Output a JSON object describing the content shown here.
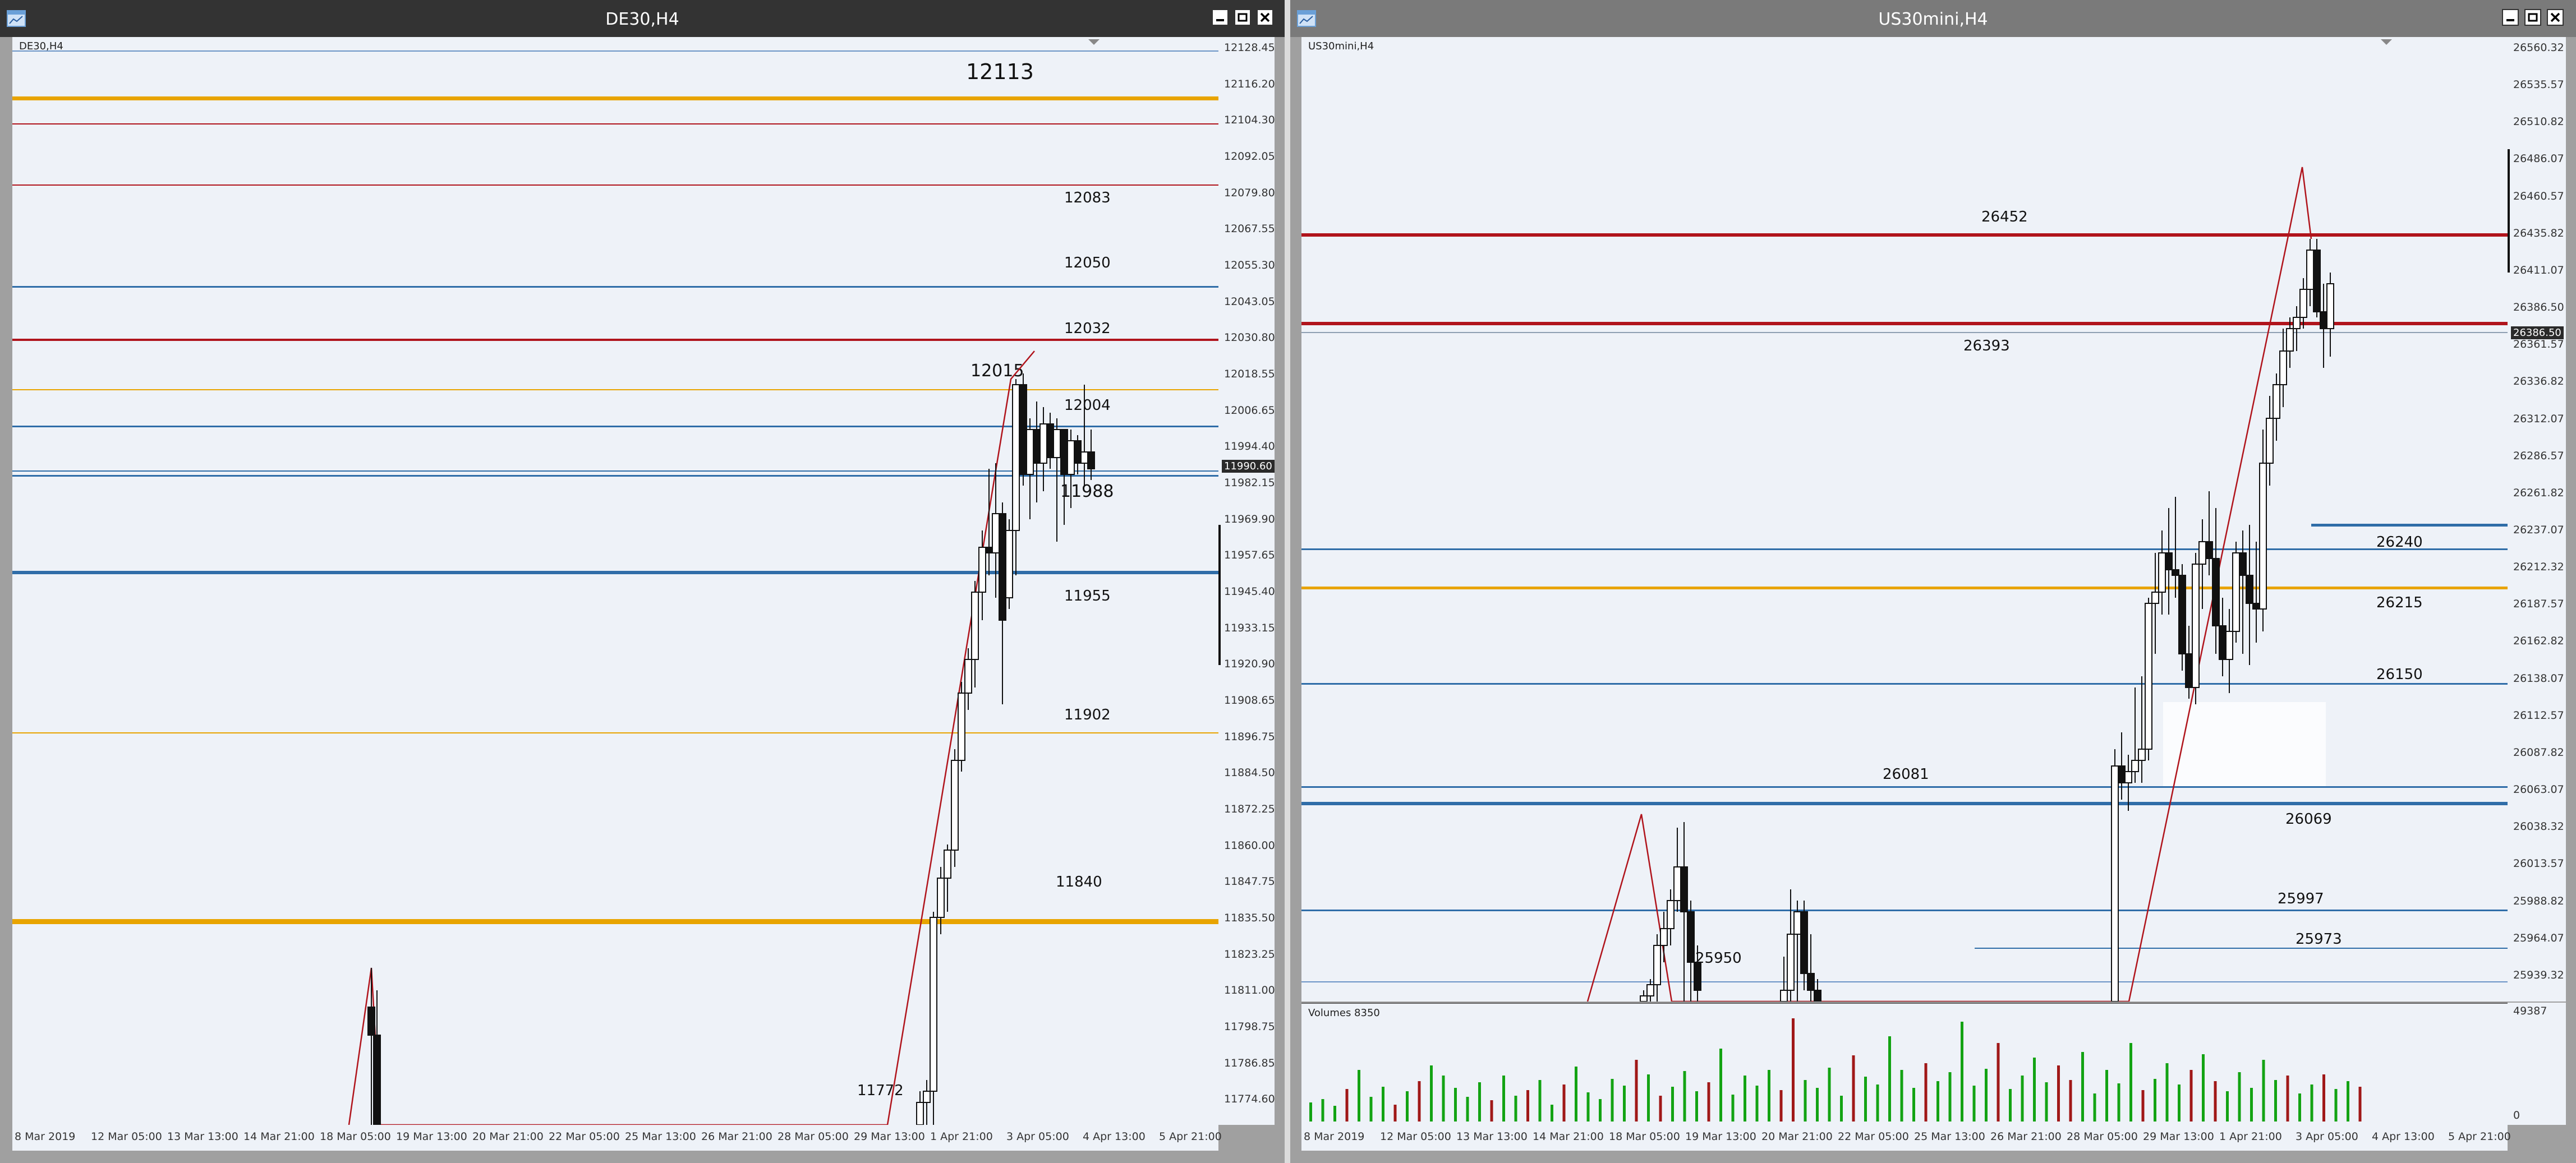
{
  "windows": [
    {
      "title": "DE30,H4",
      "symbol_label": "DE30,H4",
      "price_tag": "11990.60",
      "big_label": "12113",
      "y_ticks": [
        "12128.45",
        "12116.20",
        "12104.30",
        "12092.05",
        "12079.80",
        "12067.55",
        "12055.30",
        "12043.05",
        "12030.80",
        "12018.55",
        "12006.65",
        "11994.40",
        "11982.15",
        "11969.90",
        "11957.65",
        "11945.40",
        "11933.15",
        "11920.90",
        "11908.65",
        "11896.75",
        "11884.50",
        "11872.25",
        "11860.00",
        "11847.75",
        "11835.50",
        "11823.25",
        "11811.00",
        "11798.75",
        "11786.85",
        "11774.60"
      ],
      "x_ticks": [
        "8 Mar 2019",
        "12 Mar 05:00",
        "13 Mar 13:00",
        "14 Mar 21:00",
        "18 Mar 05:00",
        "19 Mar 13:00",
        "20 Mar 21:00",
        "22 Mar 05:00",
        "25 Mar 13:00",
        "26 Mar 21:00",
        "28 Mar 05:00",
        "29 Mar 13:00",
        "1 Apr 21:00",
        "3 Apr 05:00",
        "4 Apr 13:00",
        "5 Apr 21:00"
      ],
      "levels": [
        "12083",
        "12050",
        "12032",
        "12015",
        "12004",
        "11988",
        "11955",
        "11902",
        "11840",
        "11772"
      ]
    },
    {
      "title": "US30mini,H4",
      "symbol_label": "US30mini,H4",
      "price_tag": "26386.50",
      "volume_label": "Volumes 8350",
      "volume_scale": [
        "49387",
        "0"
      ],
      "y_ticks": [
        "26560.32",
        "26535.57",
        "26510.82",
        "26486.07",
        "26460.57",
        "26435.82",
        "26411.07",
        "26386.50",
        "26361.57",
        "26336.82",
        "26312.07",
        "26286.57",
        "26261.82",
        "26237.07",
        "26212.32",
        "26187.57",
        "26162.82",
        "26138.07",
        "26112.57",
        "26087.82",
        "26063.07",
        "26038.32",
        "26013.57",
        "25988.82",
        "25964.07",
        "25939.32"
      ],
      "x_ticks": [
        "8 Mar 2019",
        "12 Mar 05:00",
        "13 Mar 13:00",
        "14 Mar 21:00",
        "18 Mar 05:00",
        "19 Mar 13:00",
        "20 Mar 21:00",
        "22 Mar 05:00",
        "25 Mar 13:00",
        "26 Mar 21:00",
        "28 Mar 05:00",
        "29 Mar 13:00",
        "1 Apr 21:00",
        "3 Apr 05:00",
        "4 Apr 13:00",
        "5 Apr 21:00"
      ],
      "levels": [
        "26452",
        "26393",
        "26240",
        "26215",
        "26150",
        "26081",
        "26069",
        "25997",
        "25973",
        "25950"
      ]
    }
  ],
  "colors": {
    "titlebar_active": "#333333",
    "titlebar_inactive": "#7a7a7a",
    "chart_bg": "#eef2f8",
    "red_line": "#b0141c",
    "blue_line": "#2f6da8",
    "gold_line": "#e8a400",
    "volume_up": "#13a313",
    "volume_down": "#a01818"
  },
  "icons": {
    "window": "chart-window-icon",
    "minimize": "minimize-icon",
    "restore": "restore-icon",
    "close": "close-icon"
  }
}
